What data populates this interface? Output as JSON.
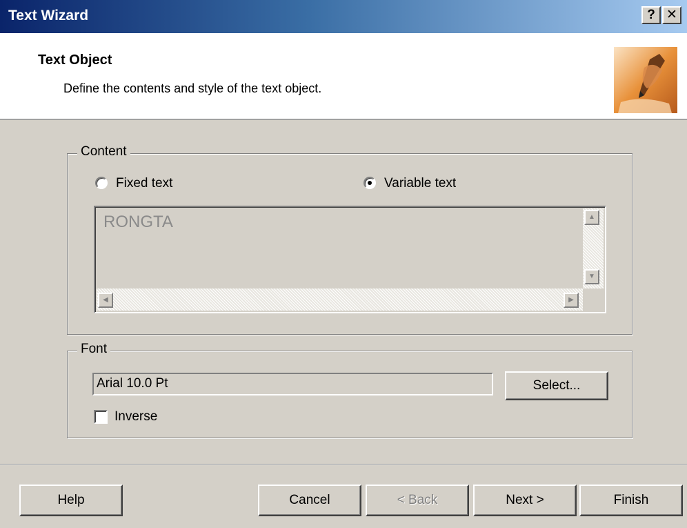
{
  "window": {
    "title": "Text Wizard",
    "help_glyph": "?",
    "close_glyph": "✕"
  },
  "header": {
    "title": "Text Object",
    "subtitle": "Define the contents and style of the text object.",
    "icon": "pen-writing-icon"
  },
  "content_group": {
    "legend": "Content",
    "fixed_text_label": "Fixed text",
    "variable_text_label": "Variable text",
    "selected": "Variable text",
    "text_value": "RONGTA"
  },
  "font_group": {
    "legend": "Font",
    "font_value": "Arial 10.0 Pt",
    "select_label": "Select...",
    "inverse_label": "Inverse",
    "inverse_checked": false
  },
  "buttons": {
    "help": "Help",
    "cancel": "Cancel",
    "back": "< Back",
    "next": "Next >",
    "finish": "Finish"
  }
}
